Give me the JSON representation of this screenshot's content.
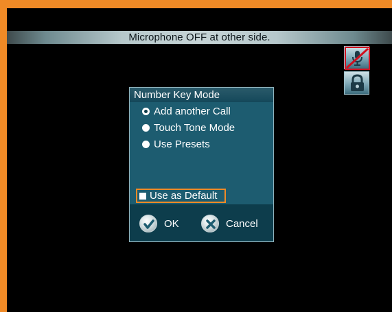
{
  "banner": {
    "text": "Microphone OFF at other side."
  },
  "status_icons": [
    "microphone-muted-icon",
    "lock-icon"
  ],
  "dialog": {
    "title": "Number Key Mode",
    "options": [
      {
        "label": "Add another Call",
        "selected": true
      },
      {
        "label": "Touch Tone Mode",
        "selected": false
      },
      {
        "label": "Use Presets",
        "selected": false
      }
    ],
    "default_checkbox": {
      "label": "Use as Default",
      "checked": false
    },
    "ok_label": "OK",
    "cancel_label": "Cancel"
  },
  "colors": {
    "frame": "#f08a26",
    "dialog_bg": "#0d3d4c",
    "dialog_body": "#1d5c70",
    "focus": "#f08a26"
  }
}
